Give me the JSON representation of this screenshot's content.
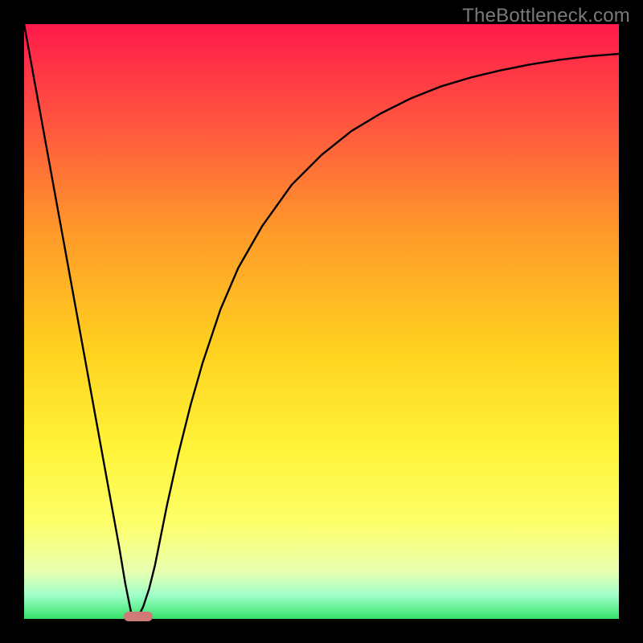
{
  "watermark": "TheBottleneck.com",
  "colors": {
    "frame": "#000000",
    "curve": "#000000",
    "marker": "#cf7a77",
    "watermark": "#7a7a7a",
    "gradient_stops": [
      "#ff1a4b",
      "#ff5a3e",
      "#ff9a2a",
      "#ffd21f",
      "#fff53b",
      "#fdff6a",
      "#e8ffb0",
      "#9fffc8",
      "#35e26b"
    ]
  },
  "chart_data": {
    "type": "line",
    "title": "",
    "xlabel": "",
    "ylabel": "",
    "xlim": [
      0,
      100
    ],
    "ylim": [
      0,
      100
    ],
    "x": [
      0,
      2,
      4,
      6,
      8,
      10,
      12,
      14,
      16,
      17,
      18,
      19,
      20,
      21,
      22,
      23,
      24,
      26,
      28,
      30,
      33,
      36,
      40,
      45,
      50,
      55,
      60,
      65,
      70,
      75,
      80,
      85,
      90,
      95,
      100
    ],
    "values": [
      100,
      89,
      78,
      67,
      56,
      45,
      34,
      23,
      12,
      6,
      1,
      0,
      2,
      5,
      9,
      14,
      19,
      28,
      36,
      43,
      52,
      59,
      66,
      73,
      78,
      82,
      85,
      87.5,
      89.5,
      91,
      92.2,
      93.2,
      94,
      94.6,
      95
    ],
    "marker": {
      "x_start": 16.7,
      "x_end": 21.6,
      "y": 0.4
    },
    "grid": false,
    "legend": false
  }
}
